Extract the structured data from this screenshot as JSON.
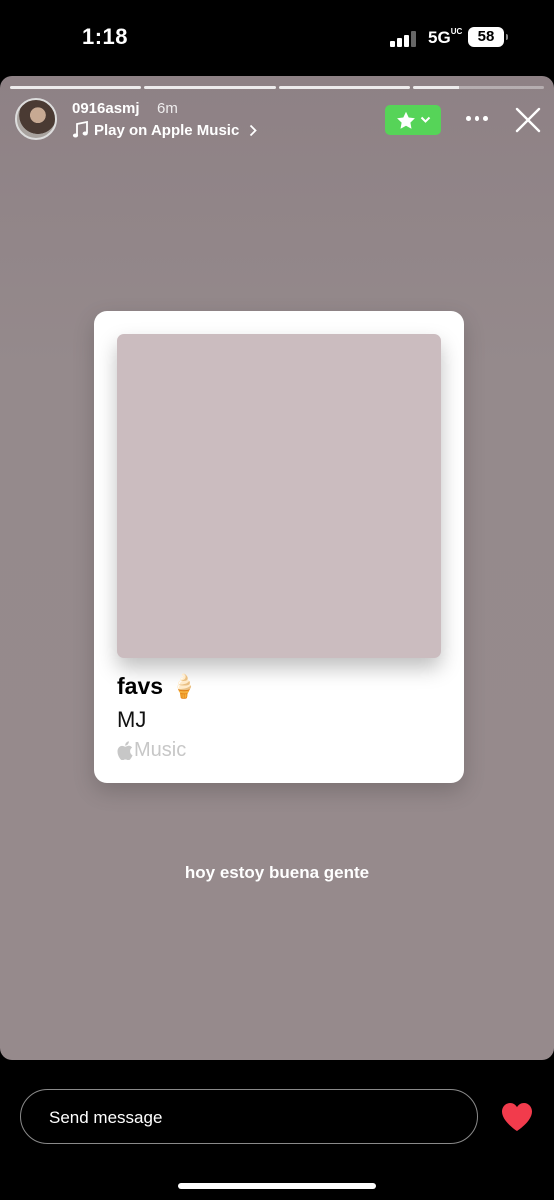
{
  "status_bar": {
    "time": "1:18",
    "network": "5G",
    "network_suffix": "UC",
    "battery": "58"
  },
  "story": {
    "username": "0916asmj",
    "time_ago": "6m",
    "music_link": "Play on Apple Music",
    "progress_segments": 4,
    "current_segment_progress": 0.35,
    "caption": "hoy estoy buena gente"
  },
  "music_card": {
    "title": "favs",
    "title_emoji": "🍦",
    "artist": "MJ",
    "service": "Music",
    "artwork_color": "#cbbcbf"
  },
  "reply": {
    "placeholder": "Send message"
  },
  "colors": {
    "favorite_green": "#56d458",
    "heart_red": "#f23b4c",
    "story_bg": "#958a8c"
  },
  "icons": [
    "note-icon",
    "chevron-right-icon",
    "star-icon",
    "chevron-down-icon",
    "more-icon",
    "close-icon",
    "apple-icon",
    "heart-icon"
  ]
}
